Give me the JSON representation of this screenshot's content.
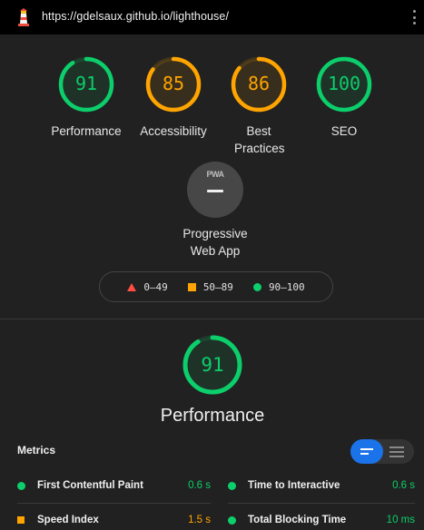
{
  "topbar": {
    "url": "https://gdelsaux.github.io/lighthouse/",
    "logo_icon": "lighthouse-icon",
    "menu_icon": "kebab-menu-icon"
  },
  "colors": {
    "pass": "#0cce6b",
    "average": "#ffa400",
    "fail": "#ff4e42",
    "accent": "#1a73e8"
  },
  "categories": [
    {
      "label": "Performance",
      "score": "91",
      "score_value": 91,
      "status": "pass"
    },
    {
      "label": "Accessibility",
      "score": "85",
      "score_value": 85,
      "status": "average"
    },
    {
      "label": "Best Practices",
      "score": "86",
      "score_value": 86,
      "status": "average"
    },
    {
      "label": "SEO",
      "score": "100",
      "score_value": 100,
      "status": "pass"
    }
  ],
  "pwa": {
    "badge": "PWA",
    "label": "Progressive Web App"
  },
  "legend": {
    "fail": "0–49",
    "average": "50–89",
    "pass": "90–100"
  },
  "performance": {
    "score": "91",
    "score_value": 91,
    "title": "Performance"
  },
  "metrics": {
    "heading": "Metrics",
    "items": [
      {
        "name": "First Contentful Paint",
        "value": "0.6 s",
        "status": "pass"
      },
      {
        "name": "Time to Interactive",
        "value": "0.6 s",
        "status": "pass"
      },
      {
        "name": "Speed Index",
        "value": "1.5 s",
        "status": "average"
      },
      {
        "name": "Total Blocking Time",
        "value": "10 ms",
        "status": "pass"
      }
    ]
  }
}
